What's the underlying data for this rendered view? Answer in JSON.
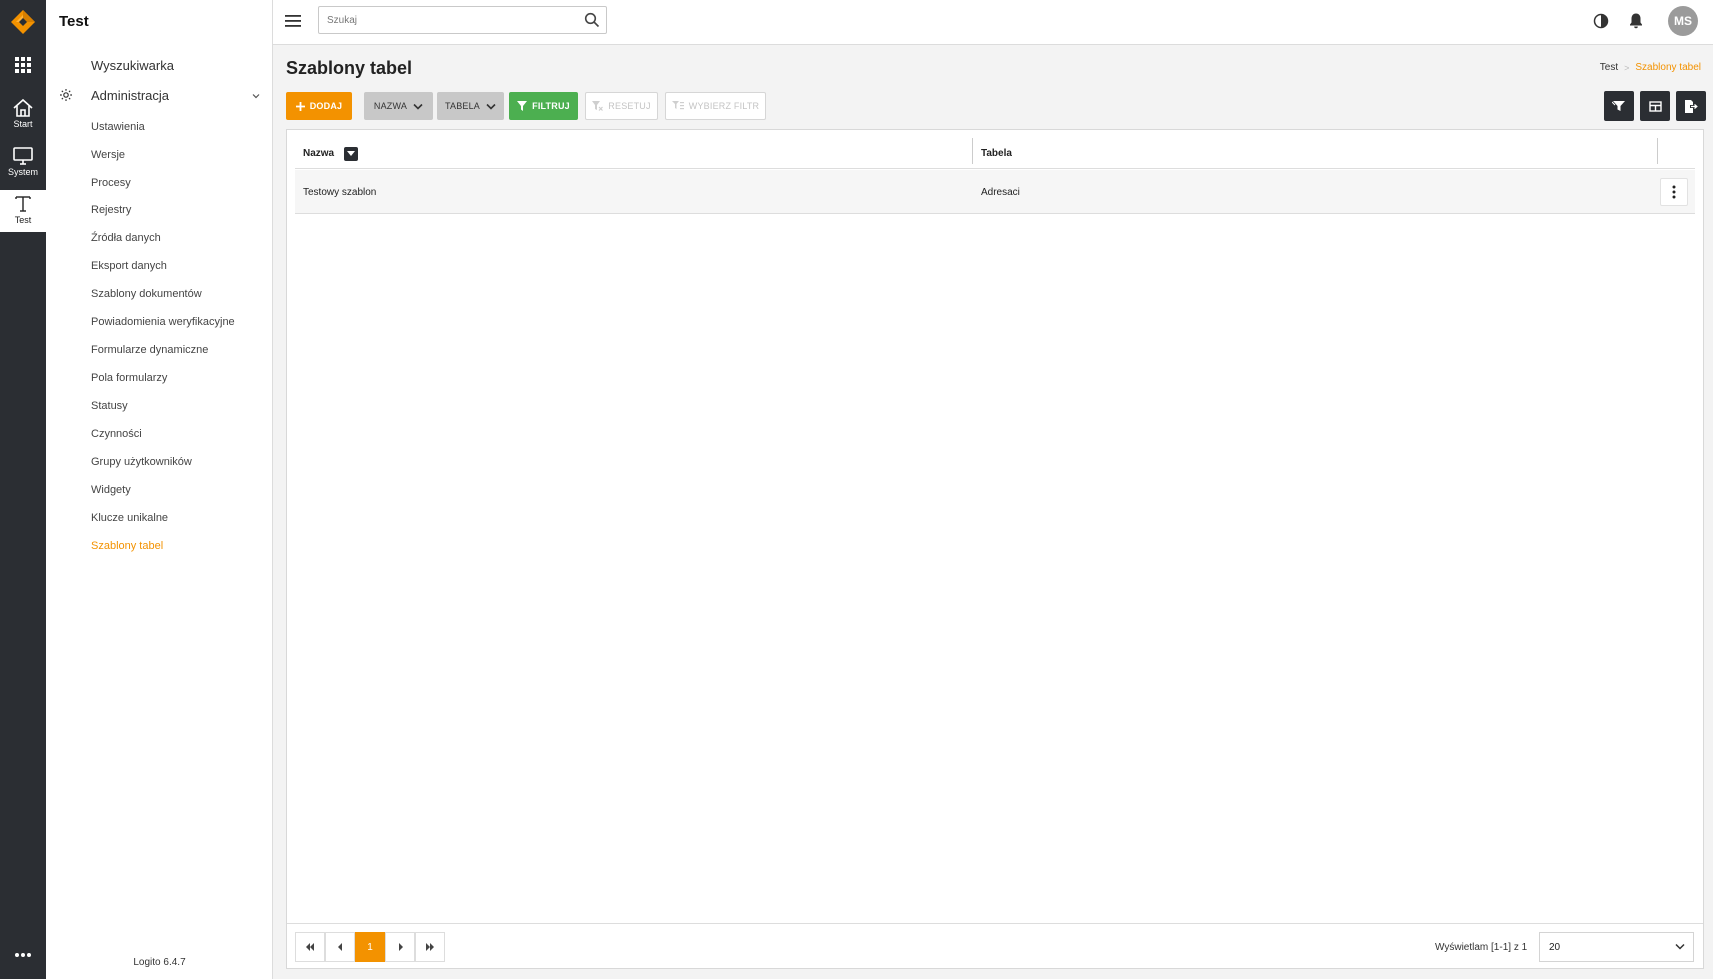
{
  "rail": {
    "items": [
      {
        "label": "Start"
      },
      {
        "label": "System"
      },
      {
        "label": "Test"
      }
    ]
  },
  "sidebar": {
    "title": "Test",
    "search_link": "Wyszukiwarka",
    "section_label": "Administracja",
    "items": [
      {
        "label": "Ustawienia",
        "active": false
      },
      {
        "label": "Wersje",
        "active": false
      },
      {
        "label": "Procesy",
        "active": false
      },
      {
        "label": "Rejestry",
        "active": false
      },
      {
        "label": "Źródła danych",
        "active": false
      },
      {
        "label": "Eksport danych",
        "active": false
      },
      {
        "label": "Szablony dokumentów",
        "active": false
      },
      {
        "label": "Powiadomienia weryfikacyjne",
        "active": false
      },
      {
        "label": "Formularze dynamiczne",
        "active": false
      },
      {
        "label": "Pola formularzy",
        "active": false
      },
      {
        "label": "Statusy",
        "active": false
      },
      {
        "label": "Czynności",
        "active": false
      },
      {
        "label": "Grupy użytkowników",
        "active": false
      },
      {
        "label": "Widgety",
        "active": false
      },
      {
        "label": "Klucze unikalne",
        "active": false
      },
      {
        "label": "Szablony tabel",
        "active": true
      }
    ],
    "version": "Logito 6.4.7"
  },
  "topbar": {
    "search_placeholder": "Szukaj",
    "avatar_initials": "MS"
  },
  "page": {
    "title": "Szablony tabel",
    "breadcrumb": {
      "home": "Test",
      "current": "Szablony tabel"
    }
  },
  "toolbar": {
    "add_label": "DODAJ",
    "filter_name_label": "NAZWA",
    "filter_table_label": "TABELA",
    "filter_label": "FILTRUJ",
    "reset_label": "RESETUJ",
    "choose_filter_label": "WYBIERZ FILTR"
  },
  "table": {
    "columns": [
      "Nazwa",
      "Tabela"
    ],
    "rows": [
      {
        "name": "Testowy szablon",
        "table": "Adresaci"
      }
    ]
  },
  "pagination": {
    "current_page": "1",
    "info": "Wyświetlam [1-1] z 1",
    "page_size": "20"
  },
  "colors": {
    "accent": "#f39200",
    "success": "#4caf50",
    "rail": "#2b2e33"
  }
}
